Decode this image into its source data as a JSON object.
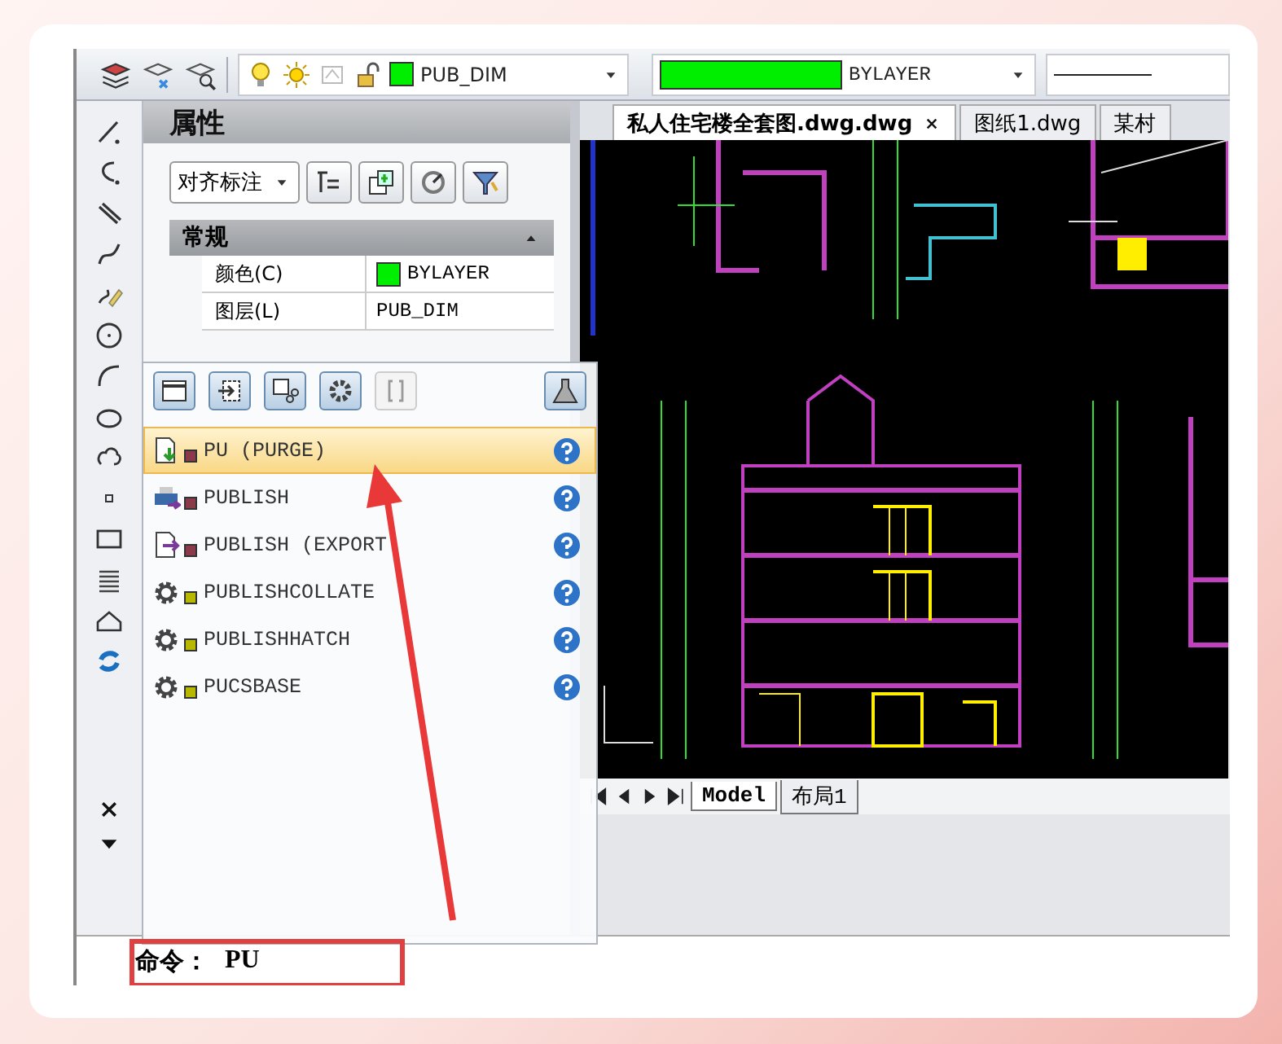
{
  "toolbar": {
    "layer_name": "PUB_DIM",
    "color_name": "BYLAYER"
  },
  "properties": {
    "title": "属性",
    "object_type": "对齐标注",
    "section": {
      "title": "常规",
      "expanded": true
    },
    "rows": [
      {
        "label": "颜色(C)",
        "value": "BYLAYER",
        "kind": "color"
      },
      {
        "label": "图层(L)",
        "value": "PUB_DIM",
        "kind": "text"
      }
    ]
  },
  "document_tabs": [
    {
      "label": "私人住宅楼全套图.dwg.dwg",
      "selected": true
    },
    {
      "label": "图纸1.dwg",
      "selected": false
    },
    {
      "label": "某村",
      "selected": false
    }
  ],
  "layout_tabs": [
    {
      "label": "Model",
      "selected": true
    },
    {
      "label": "布局1",
      "selected": false
    }
  ],
  "autocomplete": {
    "items": [
      {
        "label": "PU (PURGE)",
        "kind": "purge",
        "color": "#8b3a4a",
        "selected": true
      },
      {
        "label": "PUBLISH",
        "kind": "printer",
        "color": "#8b3a4a",
        "selected": false
      },
      {
        "label": "PUBLISH (EXPORT",
        "kind": "export",
        "color": "#8b3a4a",
        "selected": false
      },
      {
        "label": "PUBLISHCOLLATE",
        "kind": "gear",
        "color": "#b8b800",
        "selected": false
      },
      {
        "label": "PUBLISHHATCH",
        "kind": "gear",
        "color": "#b8b800",
        "selected": false
      },
      {
        "label": "PUCSBASE",
        "kind": "gear",
        "color": "#b8b800",
        "selected": false
      }
    ]
  },
  "command_line": {
    "prompt": "命令：",
    "value": "PU"
  }
}
